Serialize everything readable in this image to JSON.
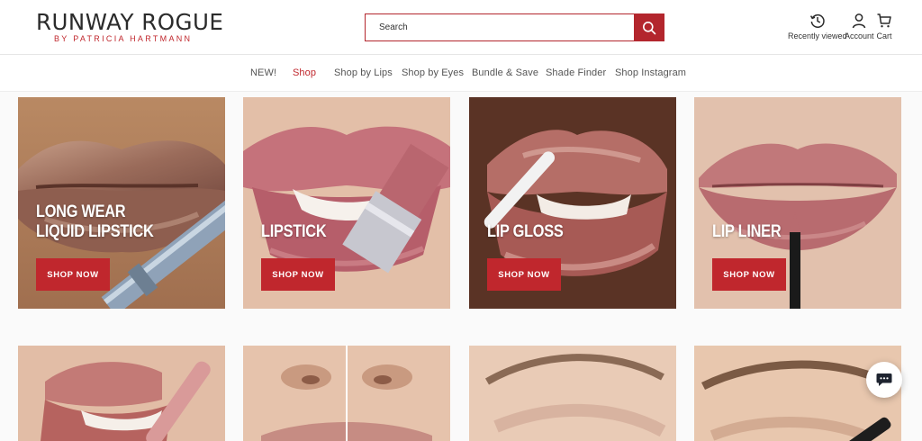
{
  "brand": {
    "name": "RUNWAY ROGUE",
    "tagline": "BY PATRICIA HARTMANN",
    "accent": "#c0272d"
  },
  "search": {
    "placeholder": "Search",
    "icon": "search-icon"
  },
  "header_tools": [
    {
      "label": "Recently viewed",
      "icon": "history-icon"
    },
    {
      "label": "Account",
      "icon": "user-icon"
    },
    {
      "label": "Cart",
      "icon": "shopping-bag-icon"
    }
  ],
  "nav": {
    "items": [
      {
        "label": "NEW!"
      },
      {
        "label": "Shop",
        "active": true
      },
      {
        "label": "Shop by Lips"
      },
      {
        "label": "Shop by Eyes"
      },
      {
        "label": "Bundle & Save"
      },
      {
        "label": "Shade Finder"
      },
      {
        "label": "Shop Instagram"
      }
    ]
  },
  "categories": [
    {
      "title_line1": "LONG WEAR",
      "title_line2": "LIQUID LIPSTICK",
      "button": "SHOP NOW"
    },
    {
      "title_line1": "LIPSTICK",
      "button": "SHOP NOW"
    },
    {
      "title_line1": "LIP GLOSS",
      "button": "SHOP NOW"
    },
    {
      "title_line1": "LIP LINER",
      "button": "SHOP NOW"
    }
  ],
  "chat": {
    "icon": "chat-bubble-icon"
  }
}
